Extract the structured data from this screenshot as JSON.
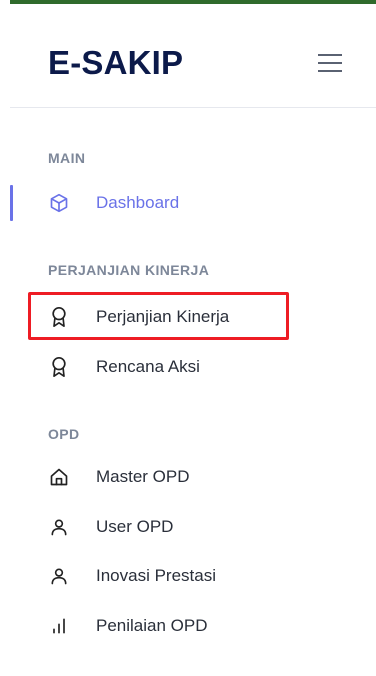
{
  "brand": {
    "title": "E-SAKIP"
  },
  "colors": {
    "brand_text": "#0c1a4a",
    "accent": "#6a72e8",
    "top_bar": "#2f6b2c",
    "highlight": "#ee1c24",
    "section_title": "#7d8799"
  },
  "header": {
    "menu_icon": "hamburger-icon"
  },
  "sidebar": {
    "sections": [
      {
        "title": "MAIN",
        "items": [
          {
            "label": "Dashboard",
            "icon": "cube-icon",
            "active": true
          }
        ]
      },
      {
        "title": "PERJANJIAN KINERJA",
        "items": [
          {
            "label": "Perjanjian Kinerja",
            "icon": "award-icon",
            "highlighted": true
          },
          {
            "label": "Rencana Aksi",
            "icon": "award-icon"
          }
        ]
      },
      {
        "title": "OPD",
        "items": [
          {
            "label": "Master OPD",
            "icon": "home-icon"
          },
          {
            "label": "User OPD",
            "icon": "user-icon"
          },
          {
            "label": "Inovasi Prestasi",
            "icon": "user-icon"
          },
          {
            "label": "Penilaian OPD",
            "icon": "bar-chart-icon"
          }
        ]
      }
    ]
  }
}
